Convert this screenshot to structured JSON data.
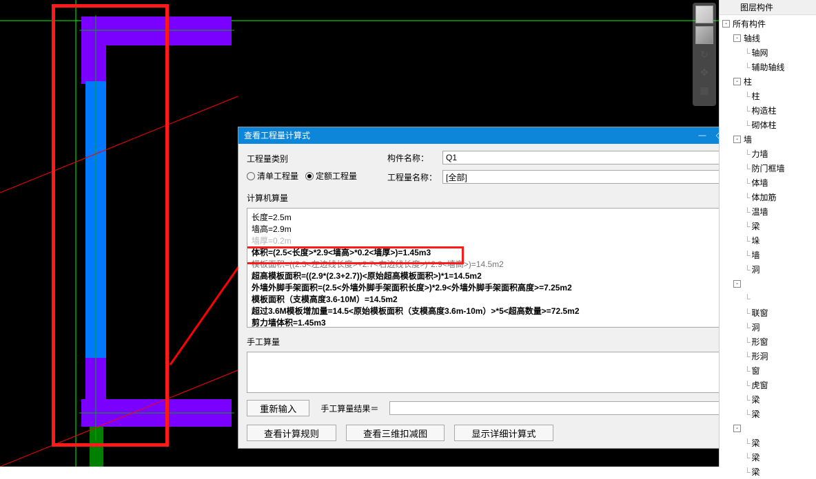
{
  "side_header": "图层构件",
  "dialog": {
    "title": "查看工程量计算式",
    "section_type": "工程量类别",
    "radio_bill": "清单工程量",
    "radio_quota": "定额工程量",
    "label_component": "构件名称：",
    "value_component": "Q1",
    "label_qtyname": "工程量名称：",
    "value_qtyname": "[全部]",
    "section_calc": "计算机算量",
    "calc_lines": {
      "l0": "长度=2.5m",
      "l1": "墙高=2.9m",
      "l2": "墙厚=0.2m",
      "l3": "体积=(2.5<长度>*2.9<墙高>*0.2<墙厚>)=1.45m3",
      "l4": "模板面积=((2.3<左边线长度>+2.7<右边线长度>)*2.9<墙高>)=14.5m2",
      "l5": "超高模板面积=((2.9*(2.3+2.7))<原始超高模板面积>)*1=14.5m2",
      "l6": "外墙外脚手架面积=(2.5<外墙外脚手架面积长度>)*2.9<外墙外脚手架面积高度>=7.25m2",
      "l7": "模板面积（支模高度3.6-10M）=14.5m2",
      "l8": "超过3.6M模板增加量=14.5<原始模板面积（支模高度3.6m-10m）>*5<超高数量>=72.5m2",
      "l9": "剪力墙体积=1.45m3"
    },
    "section_manual": "手工算量",
    "btn_reinput": "重新输入",
    "label_result": "手工算量结果＝",
    "btn_rule": "查看计算规则",
    "btn_3d": "查看三维扣减图",
    "btn_detail": "显示详细计算式"
  },
  "tree": [
    {
      "indent": 0,
      "exp": "-",
      "label": "所有构件"
    },
    {
      "indent": 1,
      "exp": "-",
      "label": "轴线"
    },
    {
      "indent": 2,
      "exp": "",
      "label": "轴网"
    },
    {
      "indent": 2,
      "exp": "",
      "label": "辅助轴线"
    },
    {
      "indent": 1,
      "exp": "-",
      "label": "柱"
    },
    {
      "indent": 2,
      "exp": "",
      "label": "柱"
    },
    {
      "indent": 2,
      "exp": "",
      "label": "构造柱"
    },
    {
      "indent": 2,
      "exp": "",
      "label": "砌体柱"
    },
    {
      "indent": 1,
      "exp": "-",
      "label": "墙",
      "cut": true,
      "cutlabel": ""
    },
    {
      "indent": 2,
      "exp": "",
      "label": "力墙",
      "cut": true
    },
    {
      "indent": 2,
      "exp": "",
      "label": "防门框墙",
      "cut": true
    },
    {
      "indent": 2,
      "exp": "",
      "label": "体墙",
      "cut": true
    },
    {
      "indent": 2,
      "exp": "",
      "label": "体加筋",
      "cut": true
    },
    {
      "indent": 2,
      "exp": "",
      "label": "温墙",
      "cut": true
    },
    {
      "indent": 2,
      "exp": "",
      "label": "梁",
      "cut": true
    },
    {
      "indent": 2,
      "exp": "",
      "label": "垛",
      "cut": true
    },
    {
      "indent": 2,
      "exp": "",
      "label": "墙",
      "cut": true
    },
    {
      "indent": 2,
      "exp": "",
      "label": "洞",
      "cut": true
    },
    {
      "indent": 1,
      "exp": "-",
      "label": "",
      "cut": true
    },
    {
      "indent": 2,
      "exp": "",
      "label": "",
      "cut": true
    },
    {
      "indent": 2,
      "exp": "",
      "label": "联窗",
      "cut": true
    },
    {
      "indent": 2,
      "exp": "",
      "label": "洞",
      "cut": true
    },
    {
      "indent": 2,
      "exp": "",
      "label": "形窗",
      "cut": true
    },
    {
      "indent": 2,
      "exp": "",
      "label": "形洞",
      "cut": true
    },
    {
      "indent": 2,
      "exp": "",
      "label": "窗",
      "cut": true
    },
    {
      "indent": 2,
      "exp": "",
      "label": "虎窗",
      "cut": true
    },
    {
      "indent": 2,
      "exp": "",
      "label": "梁",
      "cut": true
    },
    {
      "indent": 2,
      "exp": "",
      "label": "梁",
      "cut": true
    },
    {
      "indent": 1,
      "exp": "-",
      "label": "",
      "cut": true
    },
    {
      "indent": 2,
      "exp": "",
      "label": "梁",
      "cut": true
    },
    {
      "indent": 2,
      "exp": "",
      "label": "梁",
      "cut": true
    },
    {
      "indent": 2,
      "exp": "",
      "label": "梁",
      "cut": true
    }
  ]
}
